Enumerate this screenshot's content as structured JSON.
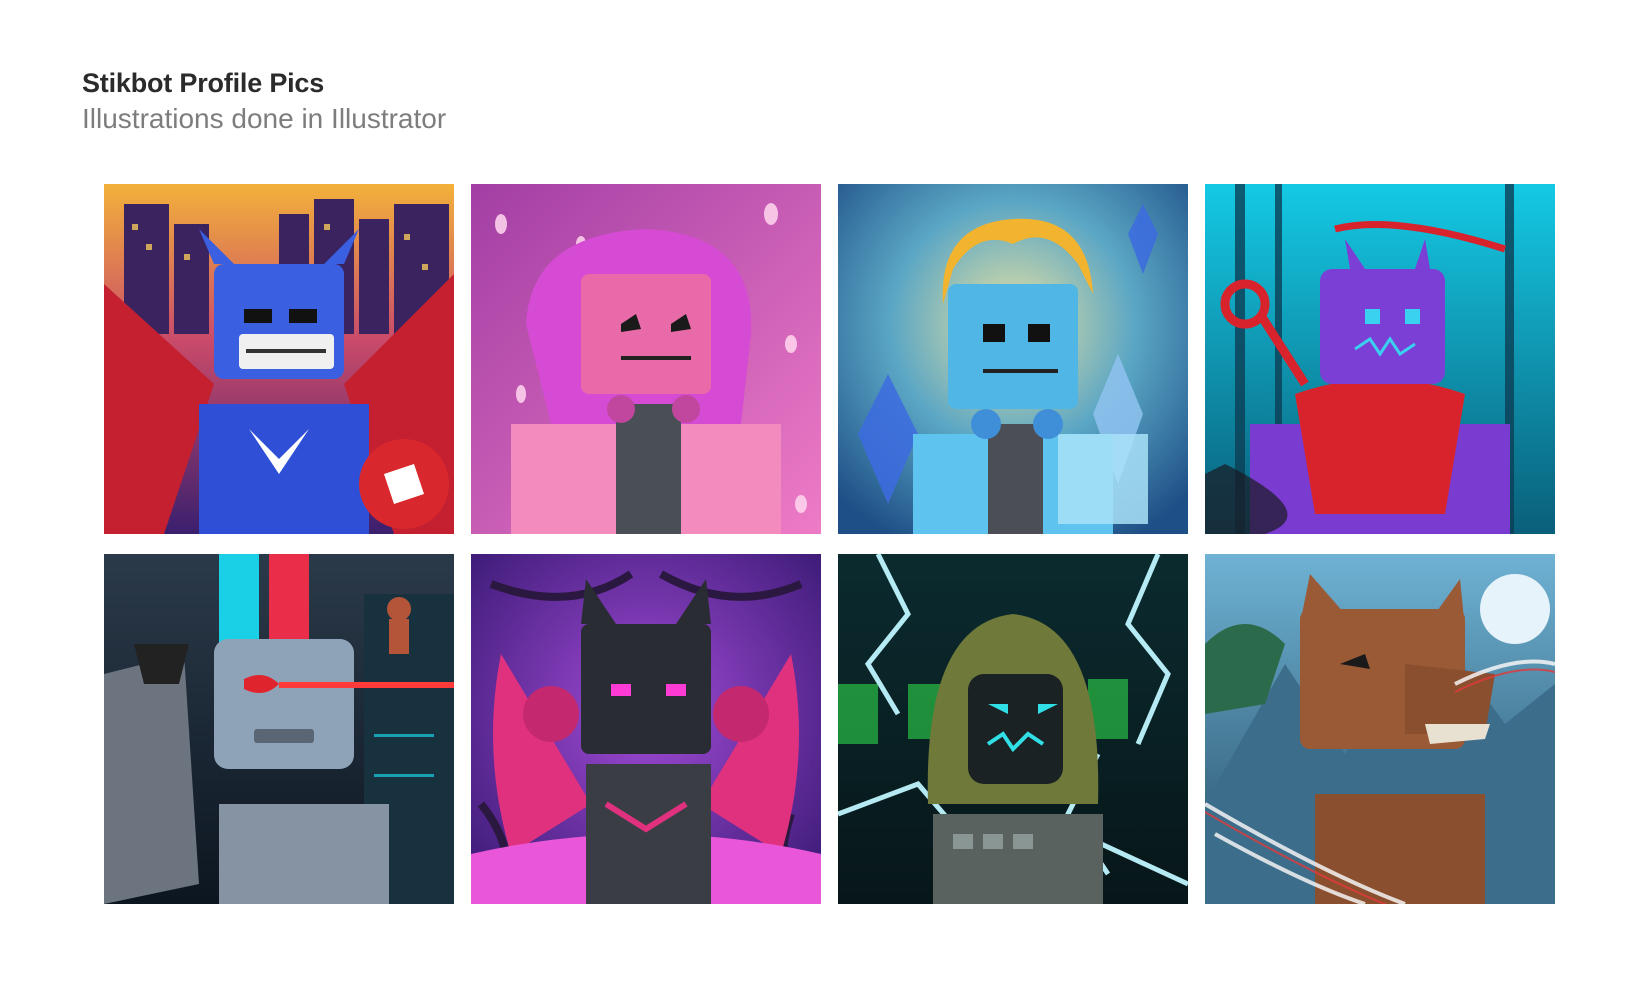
{
  "header": {
    "title": "Stikbot Profile Pics",
    "subtitle": "Illustrations done in Illustrator"
  },
  "gallery": {
    "items": [
      {
        "icon": "hero-bot-icon",
        "bg": "#5b2a8a",
        "accent": "#3a5fe0"
      },
      {
        "icon": "pink-bot-icon",
        "bg": "#c03fae",
        "accent": "#e0609f"
      },
      {
        "icon": "crystal-bot-icon",
        "bg": "#2f7fb0",
        "accent": "#5ec3ef"
      },
      {
        "icon": "ninja-bot-icon",
        "bg": "#1aa6c4",
        "accent": "#7b3fd6"
      },
      {
        "icon": "cyborg-bot-icon",
        "bg": "#1a2b3b",
        "accent": "#8fa3b8"
      },
      {
        "icon": "bat-bot-icon",
        "bg": "#6a2da0",
        "accent": "#e0317f"
      },
      {
        "icon": "hooded-bot-icon",
        "bg": "#0e3b3a",
        "accent": "#6f7a3a"
      },
      {
        "icon": "wolf-bot-icon",
        "bg": "#3a6f8a",
        "accent": "#9a5a35"
      }
    ]
  }
}
